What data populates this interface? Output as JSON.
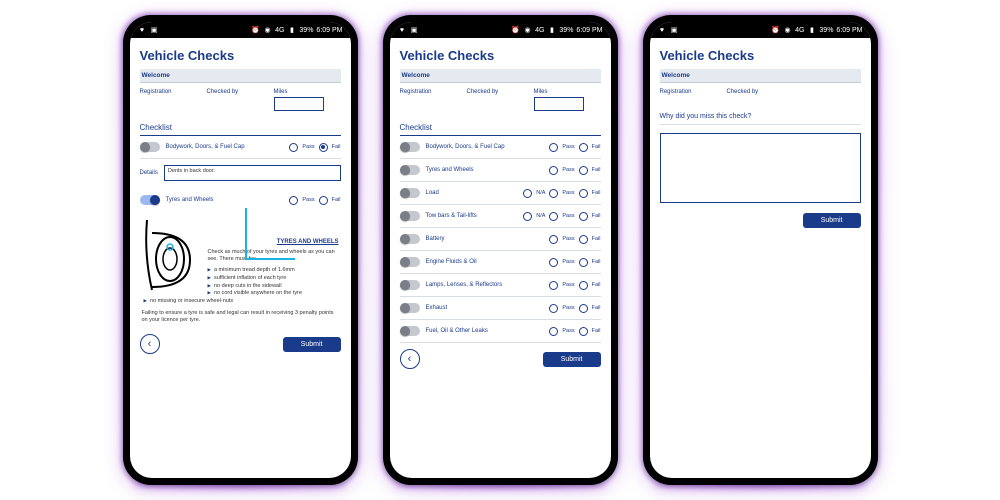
{
  "status": {
    "battery": "39%",
    "time": "6:09 PM",
    "data": "4G"
  },
  "app": {
    "title": "Vehicle Checks",
    "welcome": "Welcome",
    "registration_label": "Registration",
    "checkedby_label": "Checked by",
    "miles_label": "Miles",
    "checklist_head": "Checklist",
    "submit": "Submit",
    "details_label": "Details",
    "details_value": "Dents in back door.",
    "na_label": "N/A",
    "pass_label": "Pass",
    "fail_label": "Fail"
  },
  "screen1": {
    "items": [
      {
        "label": "Bodywork, Doors, & Fuel Cap",
        "fail": true
      },
      {
        "label": "Tyres and Wheels",
        "on": true
      }
    ],
    "info": {
      "heading": "TYRES AND WHEELS",
      "intro": "Check as much of your tyres and wheels as you can see. There must be:",
      "bullets": [
        "a minimum tread depth of 1.6mm",
        "sufficient inflation of each tyre",
        "no deep cuts in the sidewall",
        "no cord visible anywhere on the tyre",
        "no missing or insecure wheel-nuts"
      ],
      "outro": "Failing to ensure a tyre is safe and legal can result in receiving 3 penalty points on your licence per tyre."
    }
  },
  "screen2": {
    "items": [
      {
        "label": "Bodywork, Doors, & Fuel Cap"
      },
      {
        "label": "Tyres and Wheels"
      },
      {
        "label": "Load",
        "na": true
      },
      {
        "label": "Tow bars & Tail-lifts",
        "na": true
      },
      {
        "label": "Battery"
      },
      {
        "label": "Engine Fluids & Oil"
      },
      {
        "label": "Lamps, Lenses, & Reflectors"
      },
      {
        "label": "Exhaust"
      },
      {
        "label": "Fuel, Oil & Other Leaks"
      }
    ]
  },
  "screen3": {
    "question": "Why did you miss this check?"
  }
}
